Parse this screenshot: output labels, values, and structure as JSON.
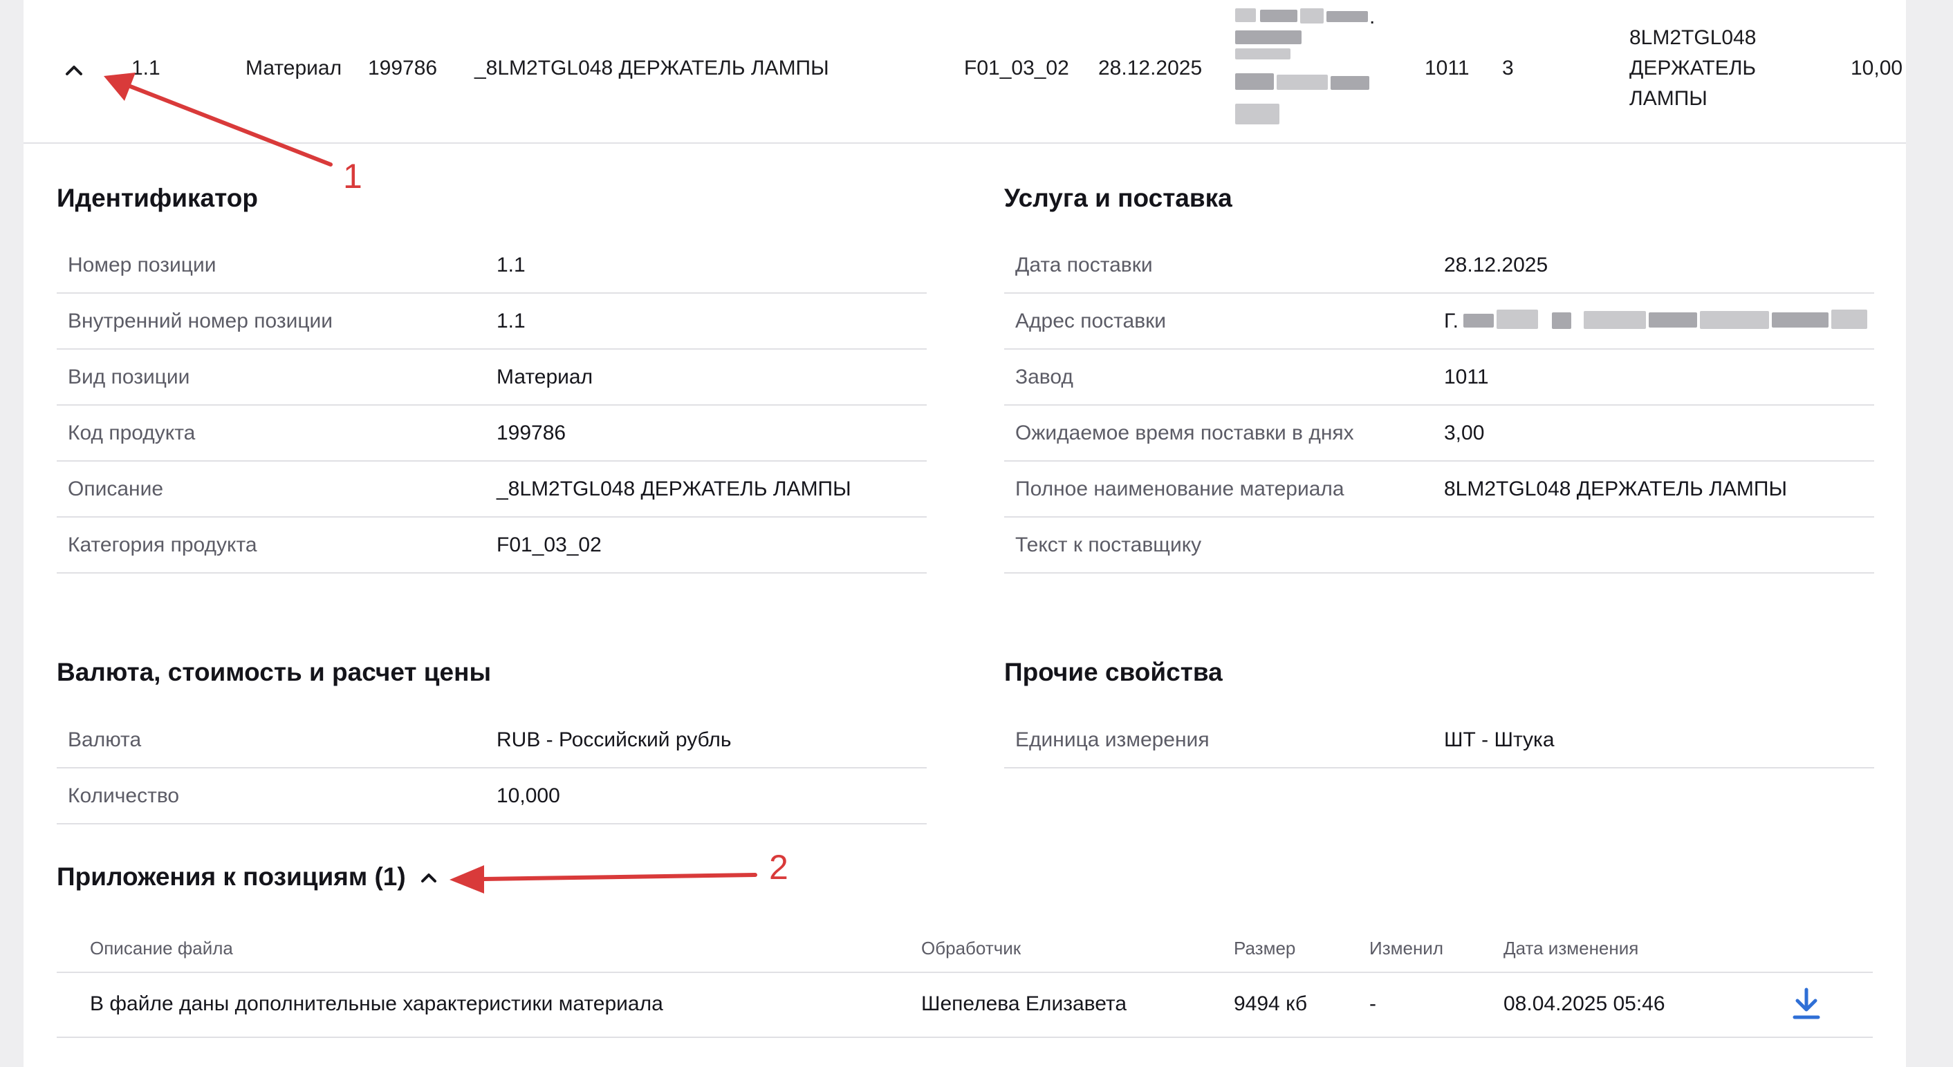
{
  "row": {
    "position": "1.1",
    "type": "Материал",
    "product_code": "199786",
    "description": "_8LM2TGL048 ДЕРЖАТЕЛЬ ЛАМПЫ",
    "category": "F01_03_02",
    "date": "28.12.2025",
    "plant": "1011",
    "days": "3",
    "full_name_lines": [
      "8LM2TGL048",
      "ДЕРЖАТЕЛЬ",
      "ЛАМПЫ"
    ],
    "qty": "10,00",
    "address_dot": "."
  },
  "identifier": {
    "title": "Идентификатор",
    "rows": [
      {
        "label": "Номер позиции",
        "value": "1.1"
      },
      {
        "label": "Внутренний номер позиции",
        "value": "1.1"
      },
      {
        "label": "Вид позиции",
        "value": "Материал"
      },
      {
        "label": "Код продукта",
        "value": "199786"
      },
      {
        "label": "Описание",
        "value": "_8LM2TGL048 ДЕРЖАТЕЛЬ ЛАМПЫ"
      },
      {
        "label": "Категория продукта",
        "value": "F01_03_02"
      }
    ]
  },
  "service": {
    "title": "Услуга и поставка",
    "rows": [
      {
        "label": "Дата поставки",
        "value": "28.12.2025"
      },
      {
        "label": "Адрес поставки",
        "value": "Г."
      },
      {
        "label": "Завод",
        "value": "1011"
      },
      {
        "label": "Ожидаемое время поставки в днях",
        "value": "3,00"
      },
      {
        "label": "Полное наименование материала",
        "value": "8LM2TGL048 ДЕРЖАТЕЛЬ ЛАМПЫ"
      },
      {
        "label": "Текст к поставщику",
        "value": ""
      }
    ]
  },
  "currency": {
    "title": "Валюта, стоимость и расчет цены",
    "rows": [
      {
        "label": "Валюта",
        "value": "RUB - Российский рубль"
      },
      {
        "label": "Количество",
        "value": "10,000"
      }
    ]
  },
  "other": {
    "title": "Прочие свойства",
    "rows": [
      {
        "label": "Единица измерения",
        "value": "ШТ - Штука"
      }
    ]
  },
  "attachments": {
    "title": "Приложения к позициям (1)",
    "headers": {
      "description": "Описание файла",
      "handler": "Обработчик",
      "size": "Размер",
      "changed_by": "Изменил",
      "changed_date": "Дата изменения"
    },
    "rows": [
      {
        "description": "В файле даны дополнительные характеристики материала",
        "handler": "Шепелева Елизавета",
        "size": "9494 кб",
        "changed_by": "-",
        "changed_date": "08.04.2025 05:46"
      }
    ]
  },
  "annotations": {
    "first": "1",
    "second": "2"
  },
  "colors": {
    "annotation": "#d93a3a",
    "link": "#2f6fd6",
    "divider": "#e0e0e4"
  },
  "icons": {
    "row_toggle": "chevron-up-icon",
    "attachments_toggle": "chevron-up-icon",
    "download": "download-icon"
  }
}
